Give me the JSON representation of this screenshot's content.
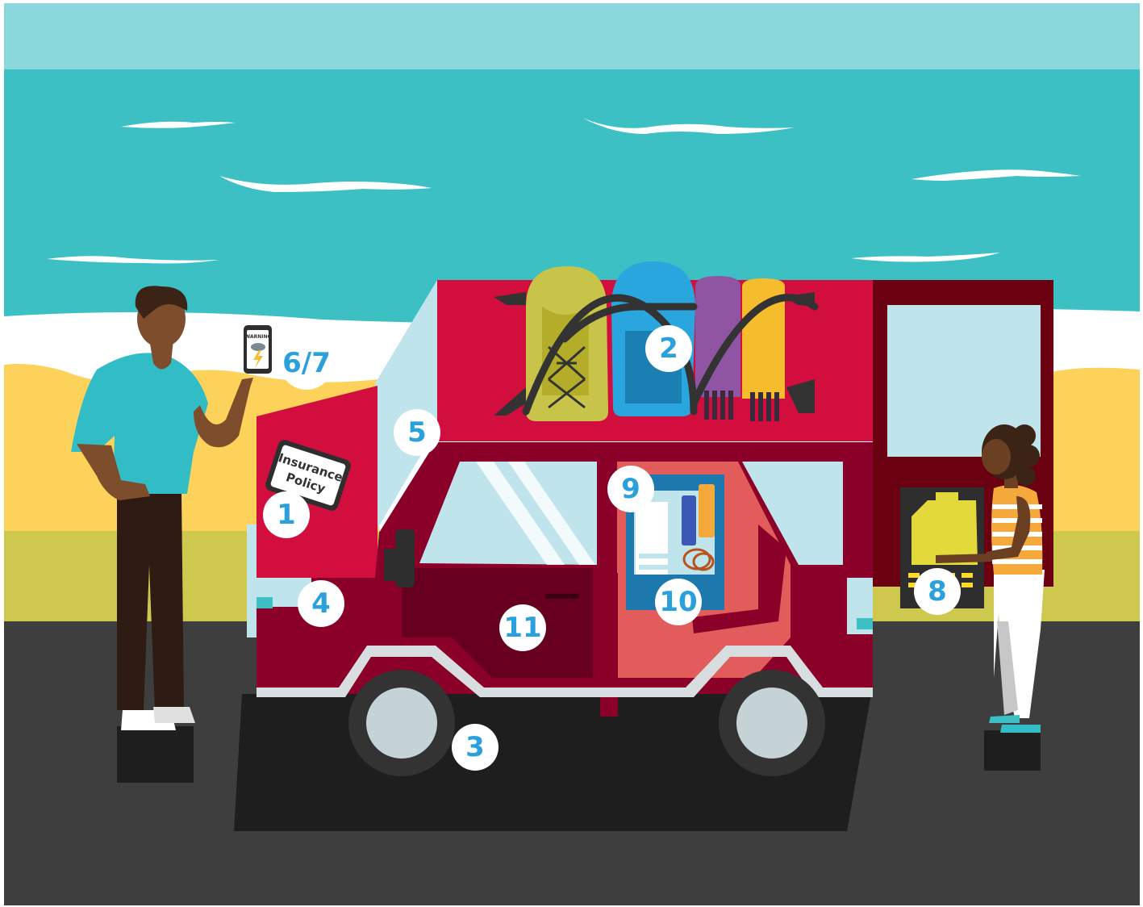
{
  "labels": {
    "insurance_policy_line1": "Insurance",
    "insurance_policy_line2": "Policy",
    "phone_warning": "WARNING"
  },
  "badges": [
    {
      "id": "1",
      "text": "1"
    },
    {
      "id": "2",
      "text": "2"
    },
    {
      "id": "3",
      "text": "3"
    },
    {
      "id": "4",
      "text": "4"
    },
    {
      "id": "5",
      "text": "5"
    },
    {
      "id": "6-7",
      "text": "6/7"
    },
    {
      "id": "8",
      "text": "8"
    },
    {
      "id": "9",
      "text": "9"
    },
    {
      "id": "10",
      "text": "10"
    },
    {
      "id": "11",
      "text": "11"
    }
  ],
  "colors": {
    "sky": "#8ad8dc",
    "sea": "#3cc0c4",
    "sand": "#fcd25a",
    "grass": "#cfc84e",
    "road": "#3e3e3e",
    "car_red": "#d10e3e",
    "car_dark_red": "#8b0028",
    "badge_text": "#2aa0dc"
  }
}
